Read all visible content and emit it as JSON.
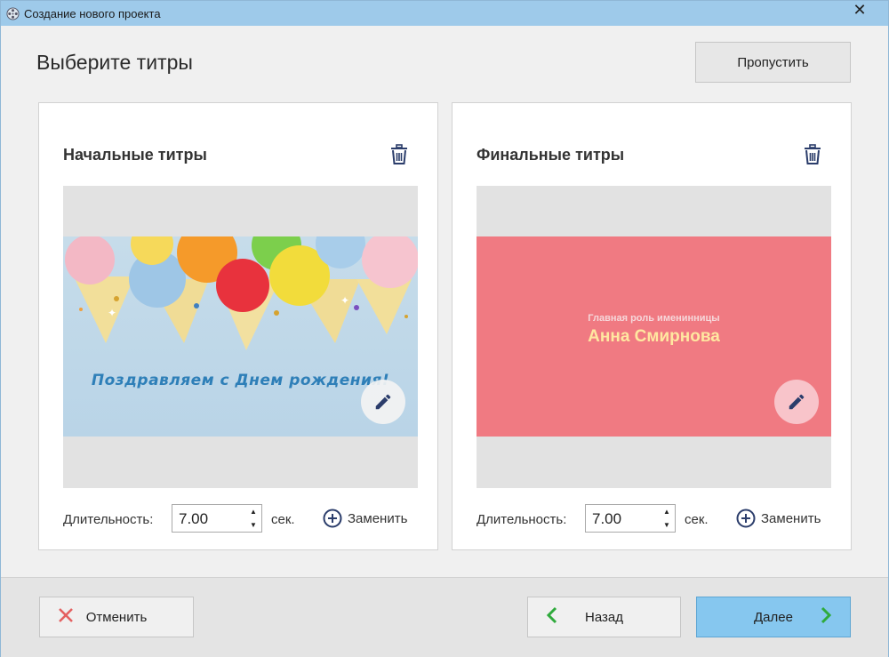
{
  "window": {
    "title": "Создание нового проекта",
    "close_label": "✕"
  },
  "heading": "Выберите титры",
  "skip_label": "Пропустить",
  "panels": {
    "start": {
      "title": "Начальные титры",
      "caption": "Поздравляем с Днем рождения!",
      "duration_label": "Длительность:",
      "duration_value": "7.00",
      "unit": "сек.",
      "replace_label": "Заменить"
    },
    "end": {
      "title": "Финальные титры",
      "caption_small": "Главная роль именинницы",
      "caption_name": "Анна Смирнова",
      "duration_label": "Длительность:",
      "duration_value": "7.00",
      "unit": "сек.",
      "replace_label": "Заменить"
    }
  },
  "footer": {
    "cancel_label": "Отменить",
    "back_label": "Назад",
    "next_label": "Далее"
  },
  "icons": {
    "trash": "trash-icon",
    "edit": "pencil-icon",
    "replace": "plus-circle-icon",
    "cancel": "close-x-icon",
    "back": "chevron-left-icon",
    "next": "chevron-right-icon"
  },
  "colors": {
    "titlebar": "#9ecaea",
    "pink_bg": "#f07a82",
    "next_button": "#86c7ef",
    "accent_green": "#2faa3c",
    "cancel_red": "#e46060",
    "icon_navy": "#2b3d6b"
  }
}
